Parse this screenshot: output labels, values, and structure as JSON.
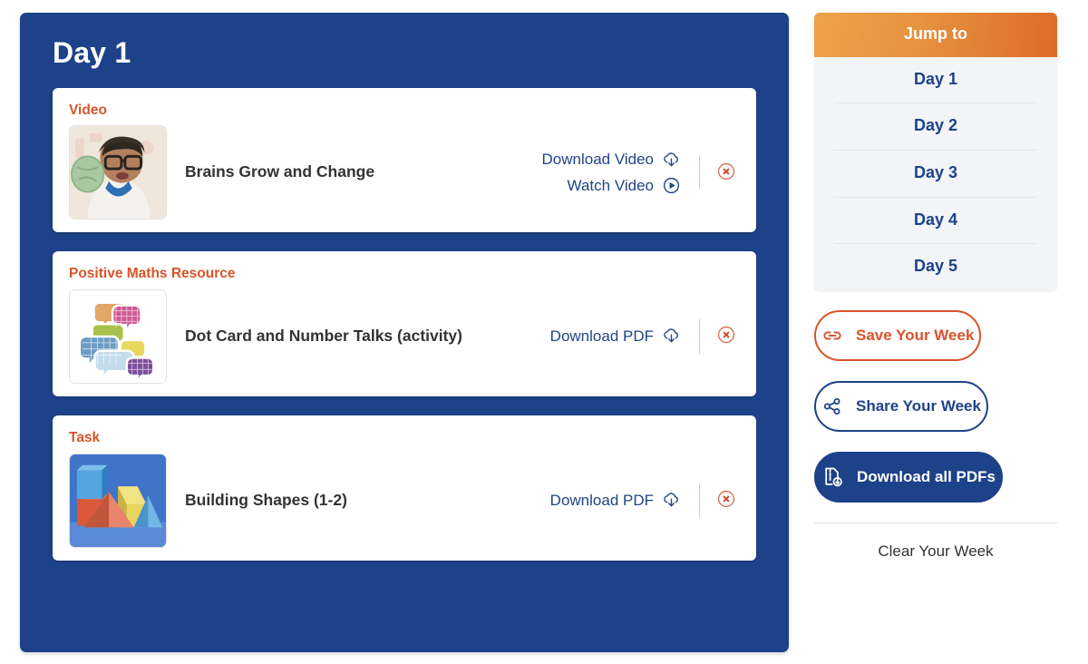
{
  "day_panel": {
    "title": "Day 1",
    "cards": [
      {
        "kicker": "Video",
        "title": "Brains Grow and Change",
        "thumb_name": "video-thumbnail-brains-grow-and-change",
        "thumb_alt": "Person holding a green brain model",
        "links": [
          {
            "label": "Download Video",
            "icon": "cloud-download-icon"
          },
          {
            "label": "Watch Video",
            "icon": "play-circle-icon"
          }
        ],
        "remove_icon": "circle-x-remove-icon"
      },
      {
        "kicker": "Positive Maths Resource",
        "title": "Dot Card and Number Talks (activity)",
        "thumb_name": "resource-thumbnail-dot-card-and-number-talks",
        "thumb_alt": "Colourful speech bubbles",
        "links": [
          {
            "label": "Download PDF",
            "icon": "cloud-download-icon"
          }
        ],
        "remove_icon": "circle-x-remove-icon"
      },
      {
        "kicker": "Task",
        "title": "Building Shapes (1-2)",
        "thumb_name": "task-thumbnail-building-shapes",
        "thumb_alt": "Coloured 3D paper shapes on blue background",
        "links": [
          {
            "label": "Download PDF",
            "icon": "cloud-download-icon"
          }
        ],
        "remove_icon": "circle-x-remove-icon"
      }
    ]
  },
  "sidebar": {
    "jump_to": {
      "header": "Jump to",
      "items": [
        {
          "label": "Day 1"
        },
        {
          "label": "Day 2"
        },
        {
          "label": "Day 3"
        },
        {
          "label": "Day 4"
        },
        {
          "label": "Day 5"
        }
      ]
    },
    "buttons": [
      {
        "label": "Save Your Week",
        "icon": "link-chain-icon"
      },
      {
        "label": "Share Your Week",
        "icon": "share-nodes-icon"
      },
      {
        "label": "Download all PDFs",
        "icon": "file-zipper-download-icon"
      }
    ],
    "clear_label": "Clear Your Week"
  },
  "colors": {
    "panel_blue": "#1d4289",
    "accent_orange": "#d9542a",
    "link_navy": "#1f4586",
    "list_bg": "#f2f4f8"
  }
}
